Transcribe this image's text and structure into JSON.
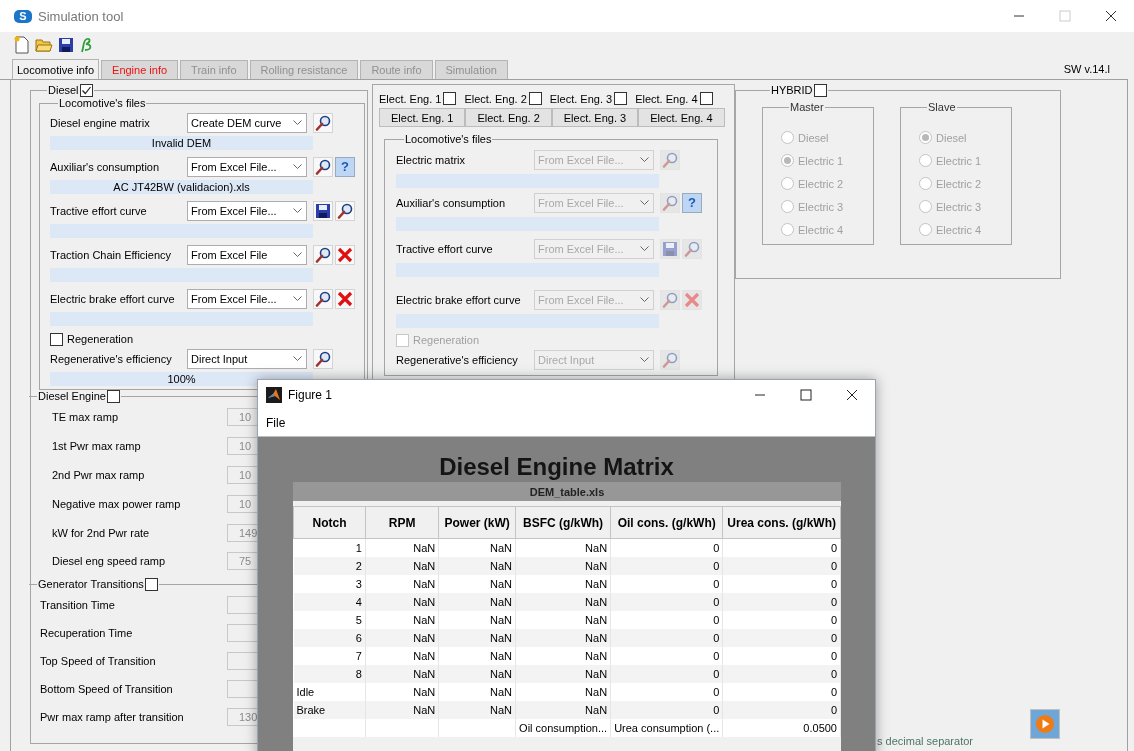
{
  "window": {
    "logo": "S",
    "title": "Simulation tool"
  },
  "tabs": [
    {
      "label": "Locomotive info",
      "selected": true,
      "disabled": false,
      "warning": false
    },
    {
      "label": "Engine info",
      "selected": false,
      "disabled": false,
      "warning": true
    },
    {
      "label": "Train info",
      "selected": false,
      "disabled": true,
      "warning": false
    },
    {
      "label": "Rolling resistance",
      "selected": false,
      "disabled": true,
      "warning": false
    },
    {
      "label": "Route info",
      "selected": false,
      "disabled": true,
      "warning": false
    },
    {
      "label": "Simulation",
      "selected": false,
      "disabled": true,
      "warning": false
    }
  ],
  "version": "SW v.14.l",
  "diesel": {
    "title": "Diesel",
    "checked": true,
    "files": {
      "title": "Locomotive's files",
      "rows": [
        {
          "label": "Diesel engine matrix",
          "source": "Create DEM curve",
          "disabled": false,
          "buttons": [
            {
              "kind": "search",
              "disabled": false
            }
          ],
          "info": "Invalid DEM"
        },
        {
          "label": "Auxiliar's consumption",
          "source": "From Excel File...",
          "disabled": false,
          "buttons": [
            {
              "kind": "search",
              "disabled": false
            },
            {
              "kind": "help",
              "label": "?",
              "disabled": false
            }
          ],
          "info": "AC JT42BW (validacion).xls"
        },
        {
          "label": "Tractive effort curve",
          "source": "From Excel File...",
          "disabled": false,
          "buttons": [
            {
              "kind": "save",
              "disabled": false
            },
            {
              "kind": "search",
              "disabled": false
            }
          ]
        },
        {
          "label": "Traction Chain Efficiency",
          "source": "From Excel File",
          "disabled": false,
          "buttons": [
            {
              "kind": "search",
              "disabled": false
            },
            {
              "kind": "delete",
              "disabled": false
            }
          ]
        },
        {
          "label": "Electric brake effort curve",
          "source": "From Excel File...",
          "disabled": false,
          "buttons": [
            {
              "kind": "search",
              "disabled": false
            },
            {
              "kind": "delete",
              "disabled": false
            }
          ]
        }
      ],
      "regeneration": {
        "label": "Regeneration",
        "checked": false,
        "disabled": false
      },
      "efficiency": {
        "label": "Regenerative's  efficiency",
        "source": "Direct Input",
        "disabled": false,
        "buttons": [
          {
            "kind": "search",
            "disabled": false
          }
        ],
        "info": "100%"
      }
    },
    "engine": {
      "title": "Diesel Engine",
      "checked": false,
      "params": [
        {
          "label": "TE max ramp",
          "value": "10"
        },
        {
          "label": "1st Pwr max ramp",
          "value": "10"
        },
        {
          "label": "2nd Pwr max ramp",
          "value": "10"
        },
        {
          "label": "Negative max power ramp",
          "value": "10"
        },
        {
          "label": "kW for 2nd Pwr rate",
          "value": "149"
        },
        {
          "label": "Diesel eng speed ramp",
          "value": "75"
        }
      ]
    },
    "generator": {
      "title": "Generator Transitions",
      "checked": false,
      "params": [
        {
          "label": "Transition Time"
        },
        {
          "label": "Recuperation Time"
        },
        {
          "label": "Top Speed of Transition"
        },
        {
          "label": "Bottom Speed of Transition"
        },
        {
          "label": "Pwr max ramp after transition",
          "value": "130"
        }
      ]
    }
  },
  "electric": {
    "enables": [
      {
        "label": "Elect. Eng. 1",
        "checked": false
      },
      {
        "label": "Elect. Eng. 2",
        "checked": false
      },
      {
        "label": "Elect. Eng. 3",
        "checked": false
      },
      {
        "label": "Elect. Eng. 4",
        "checked": false
      }
    ],
    "tabs": [
      "Elect. Eng. 1",
      "Elect. Eng. 2",
      "Elect. Eng. 3",
      "Elect. Eng. 4"
    ],
    "files": {
      "title": "Locomotive's files",
      "rows": [
        {
          "label": "Electric  matrix",
          "source": "From Excel File...",
          "disabled": true,
          "buttons": [
            {
              "kind": "search",
              "disabled": true
            }
          ]
        },
        {
          "label": "Auxiliar's consumption",
          "source": "From Excel File...",
          "disabled": true,
          "buttons": [
            {
              "kind": "search",
              "disabled": true
            },
            {
              "kind": "help",
              "label": "?",
              "disabled": false
            }
          ]
        },
        {
          "label": "Tractive effort curve",
          "source": "From Excel File...",
          "disabled": true,
          "buttons": [
            {
              "kind": "save",
              "disabled": true
            },
            {
              "kind": "search",
              "disabled": true
            }
          ]
        },
        {
          "label": "Electric brake effort curve",
          "source": "From Excel File...",
          "disabled": true,
          "buttons": [
            {
              "kind": "search",
              "disabled": true
            },
            {
              "kind": "delete",
              "disabled": true
            }
          ]
        }
      ],
      "regeneration": {
        "label": "Regeneration",
        "checked": false,
        "disabled": true
      },
      "efficiency": {
        "label": "Regenerative's  efficiency",
        "source": "Direct Input",
        "disabled": true,
        "buttons": [
          {
            "kind": "search",
            "disabled": true
          }
        ]
      }
    }
  },
  "hybrid": {
    "title": "HYBRID",
    "checked": false,
    "groups": [
      {
        "title": "Master",
        "options": [
          {
            "label": "Diesel",
            "selected": false
          },
          {
            "label": "Electric 1",
            "selected": true
          },
          {
            "label": "Electric 2",
            "selected": false
          },
          {
            "label": "Electric 3",
            "selected": false
          },
          {
            "label": "Electric 4",
            "selected": false
          }
        ]
      },
      {
        "title": "Slave",
        "options": [
          {
            "label": "Diesel",
            "selected": true
          },
          {
            "label": "Electric 1",
            "selected": false
          },
          {
            "label": "Electric 2",
            "selected": false
          },
          {
            "label": "Electric 3",
            "selected": false
          },
          {
            "label": "Electric 4",
            "selected": false
          }
        ]
      }
    ]
  },
  "footer_note": "s decimal separator",
  "figure": {
    "title": "Figure 1",
    "menu": [
      "File"
    ],
    "heading": "Diesel Engine Matrix",
    "file": "DEM_table.xls",
    "columns": [
      "Notch",
      "RPM",
      "Power (kW)",
      "BSFC (g/kWh)",
      "Oil cons. (g/kWh)",
      "Urea cons. (g/kWh)"
    ],
    "rows": [
      {
        "kind": "number",
        "cells": [
          "1",
          "NaN",
          "NaN",
          "NaN",
          "0",
          "0"
        ]
      },
      {
        "kind": "number",
        "cells": [
          "2",
          "NaN",
          "NaN",
          "NaN",
          "0",
          "0"
        ]
      },
      {
        "kind": "number",
        "cells": [
          "3",
          "NaN",
          "NaN",
          "NaN",
          "0",
          "0"
        ]
      },
      {
        "kind": "number",
        "cells": [
          "4",
          "NaN",
          "NaN",
          "NaN",
          "0",
          "0"
        ]
      },
      {
        "kind": "number",
        "cells": [
          "5",
          "NaN",
          "NaN",
          "NaN",
          "0",
          "0"
        ]
      },
      {
        "kind": "number",
        "cells": [
          "6",
          "NaN",
          "NaN",
          "NaN",
          "0",
          "0"
        ]
      },
      {
        "kind": "number",
        "cells": [
          "7",
          "NaN",
          "NaN",
          "NaN",
          "0",
          "0"
        ]
      },
      {
        "kind": "number",
        "cells": [
          "8",
          "NaN",
          "NaN",
          "NaN",
          "0",
          "0"
        ]
      },
      {
        "kind": "text",
        "cells": [
          "Idle",
          "NaN",
          "NaN",
          "NaN",
          "0",
          "0"
        ]
      },
      {
        "kind": "text",
        "cells": [
          "Brake",
          "NaN",
          "NaN",
          "NaN",
          "0",
          "0"
        ]
      }
    ],
    "summary": {
      "oil": "Oil consumption...",
      "urea": "Urea consumption (...",
      "value": "0.0500"
    }
  }
}
